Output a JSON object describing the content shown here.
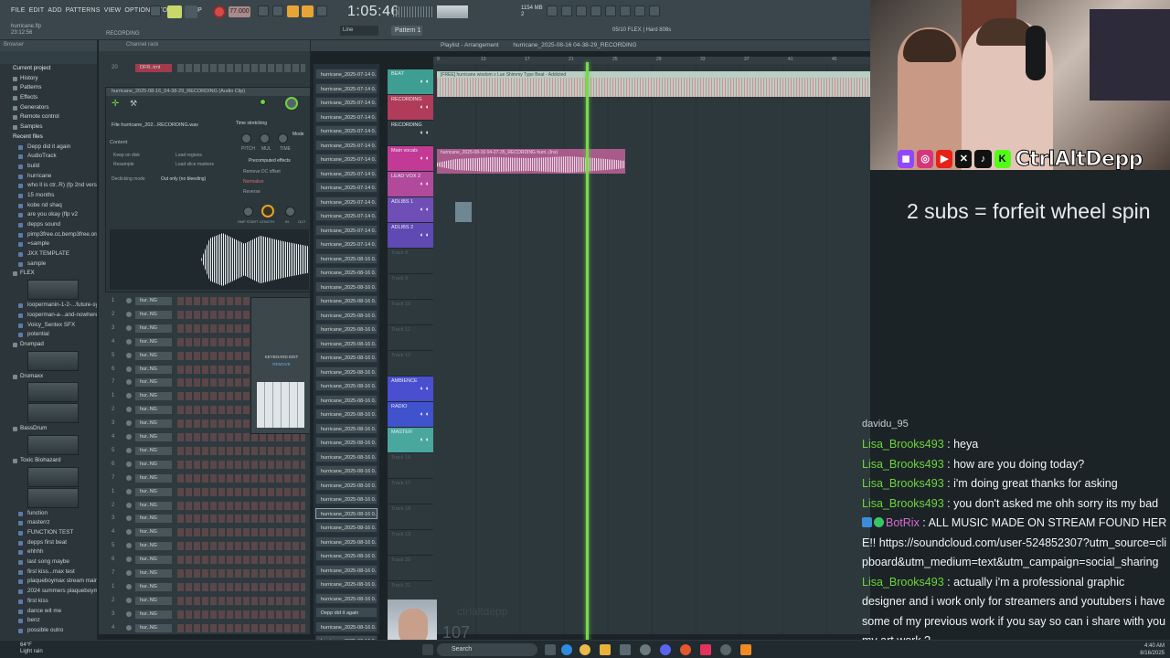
{
  "fl": {
    "menu": [
      "FILE",
      "EDIT",
      "ADD",
      "PATTERNS",
      "VIEW",
      "OPTIONS",
      "TOOLS",
      "HELP"
    ],
    "project_file": "hurricane.flp",
    "project_time": "23:12:56",
    "recording_label": "RECORDING",
    "bpm": "77.000",
    "time_display": "1:05:46",
    "cpu_info": "1154 MB\n2",
    "pattern_label": "Pattern 1",
    "snap_label": "Line",
    "hint_text": "05/10  FLEX | Hard 808s"
  },
  "browser": {
    "header": "Browser",
    "items": [
      {
        "label": "Current project",
        "kind": "section"
      },
      {
        "label": "History",
        "kind": "folder"
      },
      {
        "label": "Patterns",
        "kind": "folder"
      },
      {
        "label": "Effects",
        "kind": "folder"
      },
      {
        "label": "Generators",
        "kind": "folder"
      },
      {
        "label": "Remote control",
        "kind": "folder"
      },
      {
        "label": "Samples",
        "kind": "folder"
      },
      {
        "label": "Recent files",
        "kind": "section"
      },
      {
        "label": "Depp did it again",
        "kind": "file"
      },
      {
        "label": "AudioTrack",
        "kind": "file"
      },
      {
        "label": "build",
        "kind": "file"
      },
      {
        "label": "hurricane",
        "kind": "file"
      },
      {
        "label": "who ll is ctr..R) (fp 2nd verse",
        "kind": "file"
      },
      {
        "label": "15 months",
        "kind": "file"
      },
      {
        "label": "kobe nd shaq",
        "kind": "file"
      },
      {
        "label": "are you okay (flp v2",
        "kind": "file"
      },
      {
        "label": "depps sound",
        "kind": "file"
      },
      {
        "label": "pimp3free.cc,bemp3free.org",
        "kind": "file"
      },
      {
        "label": "=sample",
        "kind": "file"
      },
      {
        "label": "JXX TEMPLATE",
        "kind": "file"
      },
      {
        "label": "sample",
        "kind": "file"
      },
      {
        "label": "FLEX",
        "kind": "folder"
      },
      {
        "label": "",
        "kind": "thumb"
      },
      {
        "label": "loopermanin-1-2-...future-synth",
        "kind": "file"
      },
      {
        "label": "looperman-a-..and-nowhere",
        "kind": "file"
      },
      {
        "label": "Voicy_Sentex SFX",
        "kind": "file"
      },
      {
        "label": "potential",
        "kind": "file"
      },
      {
        "label": "Drumpad",
        "kind": "folder"
      },
      {
        "label": "",
        "kind": "thumb"
      },
      {
        "label": "Drumaxx",
        "kind": "folder"
      },
      {
        "label": "",
        "kind": "thumb"
      },
      {
        "label": "",
        "kind": "thumb"
      },
      {
        "label": "BassDrum",
        "kind": "folder"
      },
      {
        "label": "",
        "kind": "thumb"
      },
      {
        "label": "Toxic Biohazard",
        "kind": "folder"
      },
      {
        "label": "",
        "kind": "thumb"
      },
      {
        "label": "",
        "kind": "thumb"
      },
      {
        "label": "function",
        "kind": "file"
      },
      {
        "label": "masterrz",
        "kind": "file"
      },
      {
        "label": "FUNCTION TEST",
        "kind": "file"
      },
      {
        "label": "depps first beat",
        "kind": "file"
      },
      {
        "label": "ehhhh",
        "kind": "file"
      },
      {
        "label": "last song maybe",
        "kind": "file"
      },
      {
        "label": "first kiss...max test",
        "kind": "file"
      },
      {
        "label": "plaqueboymax stream main",
        "kind": "file"
      },
      {
        "label": "2024 summers plaqueboymax",
        "kind": "file"
      },
      {
        "label": "first kiss",
        "kind": "file"
      },
      {
        "label": "dance wit me",
        "kind": "file"
      },
      {
        "label": "benz",
        "kind": "file"
      },
      {
        "label": "possible outro",
        "kind": "file"
      }
    ],
    "tags_label": "TAGS"
  },
  "channel_rack": {
    "header": "Channel rack",
    "first_row": {
      "num": "20",
      "name": "DFR..trnt"
    },
    "rows": [
      {
        "num": "1",
        "name": "hur..NG"
      },
      {
        "num": "2",
        "name": "hur..NG"
      },
      {
        "num": "3",
        "name": "hur..NG"
      },
      {
        "num": "4",
        "name": "hur..NG"
      },
      {
        "num": "5",
        "name": "hur..NG"
      },
      {
        "num": "6",
        "name": "hur..NG"
      },
      {
        "num": "7",
        "name": "hur..NG"
      },
      {
        "num": "1",
        "name": "hur..NG"
      },
      {
        "num": "2",
        "name": "hur..NG"
      },
      {
        "num": "3",
        "name": "hur..NG"
      },
      {
        "num": "4",
        "name": "hur..NG"
      },
      {
        "num": "5",
        "name": "hur..NG"
      },
      {
        "num": "6",
        "name": "hur..NG"
      },
      {
        "num": "7",
        "name": "hur..NG"
      },
      {
        "num": "1",
        "name": "hur..NG"
      },
      {
        "num": "2",
        "name": "hur..NG"
      },
      {
        "num": "3",
        "name": "hur..NG"
      },
      {
        "num": "4",
        "name": "hur..NG"
      },
      {
        "num": "5",
        "name": "hur..NG"
      },
      {
        "num": "6",
        "name": "hur..NG"
      },
      {
        "num": "7",
        "name": "hur..NG"
      },
      {
        "num": "1",
        "name": "hur..NG"
      },
      {
        "num": "2",
        "name": "hur..NG"
      },
      {
        "num": "3",
        "name": "hur..NG"
      },
      {
        "num": "4",
        "name": "hur..NG"
      },
      {
        "num": "5",
        "name": "hur..NG"
      },
      {
        "num": "6",
        "name": "hur..NG"
      },
      {
        "num": "7",
        "name": "hur..NG"
      },
      {
        "num": "1",
        "name": "hur..NG"
      }
    ]
  },
  "clip_window": {
    "title": "hurricane_2025-08-16_04-38-29_RECORDING (Audio Clip)",
    "file_label": "File   hurricane_202...RECORDING.wav",
    "content_label": "Content",
    "keep_on_disk": "Keep on disk",
    "resample": "Resample",
    "load_regions": "Load regions",
    "load_slice": "Load slice markers",
    "declicking_label": "Declicking mode",
    "declicking_value": "Out only (no bleeding)",
    "time_stretching": "Time stretching",
    "mode_label": "Mode",
    "precomputed": "Precomputed effects",
    "remove_dc": "Remove DC offset",
    "normalize": "Normalize",
    "reverse": "Reverse",
    "knob_labels": [
      "PITCH",
      "MUL",
      "TIME"
    ],
    "knob2_labels": [
      "SMP START",
      "LENGTH",
      "IN",
      "OUT"
    ]
  },
  "keyboard_editor": {
    "title": "KEYBOARD EDIT",
    "remove_label": "REMOVE"
  },
  "playlist": {
    "title": "Playlist - Arrangement",
    "pattern_name": "hurricane_2025-08-16 04-38-29_RECORDING",
    "patterns": [
      "hurricane_2025-07-14 0..",
      "hurricane_2025-07-14 0..",
      "hurricane_2025-07-14 0..",
      "hurricane_2025-07-14 0..",
      "hurricane_2025-07-14 0..",
      "hurricane_2025-07-14 0..",
      "hurricane_2025-07-14 0..",
      "hurricane_2025-07-14 0..",
      "hurricane_2025-07-14 0..",
      "hurricane_2025-07-14 0..",
      "hurricane_2025-07-14 0..",
      "hurricane_2025-07-14 0..",
      "hurricane_2025-07-14 0..",
      "hurricane_2025-08-16 0..",
      "hurricane_2025-08-16 0..",
      "hurricane_2025-08-16 0..",
      "hurricane_2025-08-16 0..",
      "hurricane_2025-08-16 0..",
      "hurricane_2025-08-16 0..",
      "hurricane_2025-08-16 0..",
      "hurricane_2025-08-16 0..",
      "hurricane_2025-08-16 0..",
      "hurricane_2025-08-16 0..",
      "hurricane_2025-08-16 0..",
      "hurricane_2025-08-16 0..",
      "hurricane_2025-08-16 0..",
      "hurricane_2025-08-16 0..",
      "hurricane_2025-08-16 0..",
      "hurricane_2025-08-16 0..",
      "hurricane_2025-08-16 0..",
      "hurricane_2025-08-16 0..",
      "hurricane_2025-08-16 0..",
      "hurricane_2025-08-16 0..",
      "hurricane_2025-08-16 0..",
      "hurricane_2025-08-16 0..",
      "hurricane_2025-08-16 0..",
      "hurricane_2025-08-16 0..",
      "hurricane_2025-08-16 0..",
      "Depp did it again",
      "hurricane_2025-08-16 0..",
      "hurricane_2025-08-16 0.."
    ],
    "tracks": [
      {
        "name": "BEAT",
        "color": "#3f9e92",
        "h": 27
      },
      {
        "name": "RECORDING",
        "color": "#b03c5a",
        "h": 27
      },
      {
        "name": "RECORDING",
        "color": "#2e393e",
        "h": 27
      },
      {
        "name": "Main vocals",
        "color": "#c23a96",
        "h": 27
      },
      {
        "name": "LEAD VOX 2",
        "color": "#b24a9c",
        "h": 27
      },
      {
        "name": "ADLIBS 1",
        "color": "#6f4fb6",
        "h": 27
      },
      {
        "name": "ADLIBS 2",
        "color": "#5f49b2",
        "h": 27
      },
      {
        "name": "Track 8",
        "color": "",
        "h": 27
      },
      {
        "name": "Track 9",
        "color": "",
        "h": 27
      },
      {
        "name": "Track 10",
        "color": "",
        "h": 27
      },
      {
        "name": "Track 11",
        "color": "",
        "h": 27
      },
      {
        "name": "Track 12",
        "color": "",
        "h": 27
      },
      {
        "name": "AMBIENCE",
        "color": "#4a4fd0",
        "h": 27
      },
      {
        "name": "RADIO",
        "color": "#4052cc",
        "h": 27
      },
      {
        "name": "MASTER",
        "color": "#4aa79f",
        "h": 27
      },
      {
        "name": "Track 16",
        "color": "",
        "h": 27
      },
      {
        "name": "Track 17",
        "color": "",
        "h": 27
      },
      {
        "name": "Track 18",
        "color": "",
        "h": 27
      },
      {
        "name": "Track 19",
        "color": "",
        "h": 27
      },
      {
        "name": "Track 20",
        "color": "",
        "h": 27
      },
      {
        "name": "Track 21",
        "color": "",
        "h": 27
      },
      {
        "name": "Track 22",
        "color": "",
        "h": 27
      }
    ],
    "beat_clip_label": "[FREE] hurricane wisdom x Lue Shimmy Type Beat - Addicted",
    "vocal_clip_label": "hurricane_2025-08-16 04-27-35_RECORDING  hurri..(Ins)",
    "ruler_marks": [
      "9",
      "13",
      "17",
      "21",
      "25",
      "29",
      "33",
      "37",
      "41",
      "45"
    ]
  },
  "stream": {
    "handle": "CtrlAltDepp",
    "sub_goal": "2 subs = forfeit wheel spin",
    "sub_count": "107",
    "ghost_name": "ctrlaltdepp",
    "chat_cut": "davidu_95",
    "chat": [
      {
        "user": "Lisa_Brooks493",
        "msg": "heya",
        "bot": false
      },
      {
        "user": "Lisa_Brooks493",
        "msg": "how are you doing today?",
        "bot": false
      },
      {
        "user": "Lisa_Brooks493",
        "msg": "i'm doing great thanks for asking",
        "bot": false
      },
      {
        "user": "Lisa_Brooks493",
        "msg": "you don't asked me ohh sorry its my bad",
        "bot": false
      },
      {
        "user": "BotRix",
        "msg": "ALL MUSIC MADE ON STREAM FOUND HERE!! https://soundcloud.com/user-524852307?utm_source=clipboard&utm_medium=text&utm_campaign=social_sharing",
        "bot": true
      },
      {
        "user": "Lisa_Brooks493",
        "msg": "actually i'm a professional graphic designer and i work only for streamers and youtubers i have some of my previous work if you say so can i share with you my art work ?",
        "bot": false
      }
    ]
  },
  "taskbar": {
    "weather_temp": "64°F",
    "weather_desc": "Light rain",
    "search_placeholder": "Search",
    "time": "4:40 AM",
    "date": "8/16/2025"
  },
  "colors": {
    "playhead": "#7bd84f",
    "chat_user": "#6fd43a",
    "bot_user": "#d86ad0"
  }
}
